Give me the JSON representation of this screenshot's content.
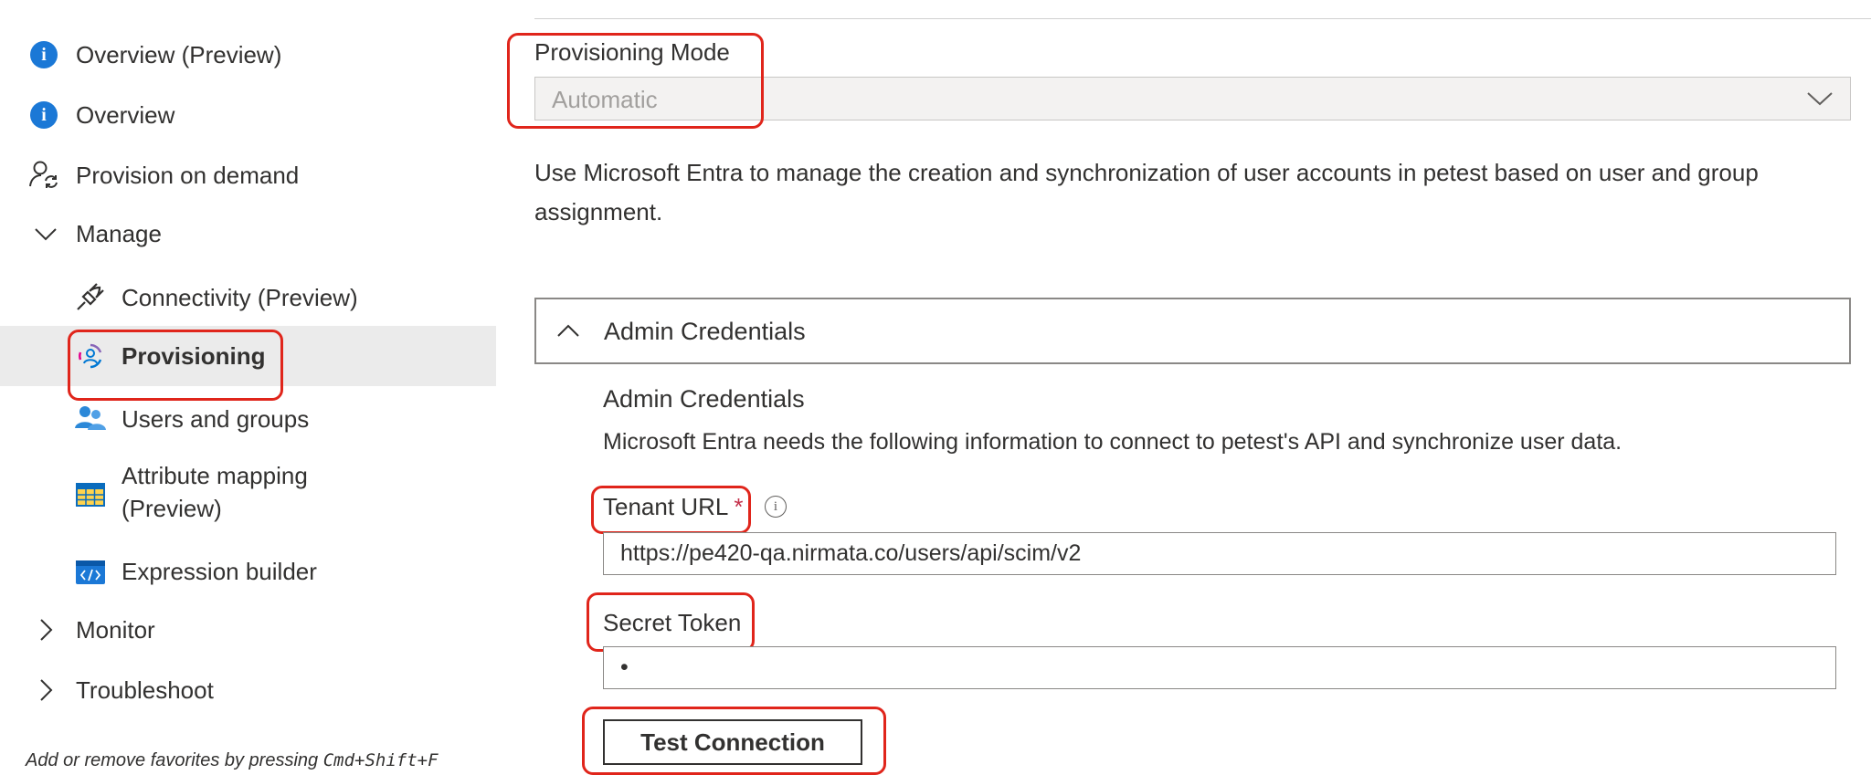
{
  "sidebar": {
    "items": [
      {
        "label": "Overview (Preview)",
        "icon": "info-icon"
      },
      {
        "label": "Overview",
        "icon": "info-icon"
      },
      {
        "label": "Provision on demand",
        "icon": "user-sync-icon"
      },
      {
        "label": "Manage",
        "icon": "chevron-down-icon"
      },
      {
        "label": "Connectivity (Preview)",
        "icon": "plug-icon"
      },
      {
        "label": "Provisioning",
        "icon": "provisioning-icon",
        "selected": true
      },
      {
        "label": "Users and groups",
        "icon": "users-icon"
      },
      {
        "label_line1": "Attribute mapping",
        "label_line2": "(Preview)",
        "icon": "table-icon"
      },
      {
        "label": "Expression builder",
        "icon": "code-icon"
      },
      {
        "label": "Monitor",
        "icon": "chevron-right-icon"
      },
      {
        "label": "Troubleshoot",
        "icon": "chevron-right-icon"
      }
    ],
    "favorites_hint": {
      "prefix": "Add or remove favorites by pressing ",
      "shortcut": "Cmd+Shift+F"
    }
  },
  "provisioning_mode": {
    "label": "Provisioning Mode",
    "value": "Automatic"
  },
  "description": "Use Microsoft Entra to manage the creation and synchronization of user accounts in petest based on user and group assignment.",
  "admin_credentials": {
    "panel_title": "Admin Credentials",
    "section_title": "Admin Credentials",
    "section_desc": "Microsoft Entra needs the following information to connect to petest's API and synchronize user data.",
    "tenant_url": {
      "label": "Tenant URL",
      "required_mark": "*",
      "value": "https://pe420-qa.nirmata.co/users/api/scim/v2"
    },
    "secret_token": {
      "label": "Secret Token",
      "value": "•"
    },
    "test_button": "Test Connection"
  },
  "colors": {
    "highlight": "#e0251b",
    "info_blue": "#1b78d6",
    "selected_bg": "#ebebeb"
  }
}
